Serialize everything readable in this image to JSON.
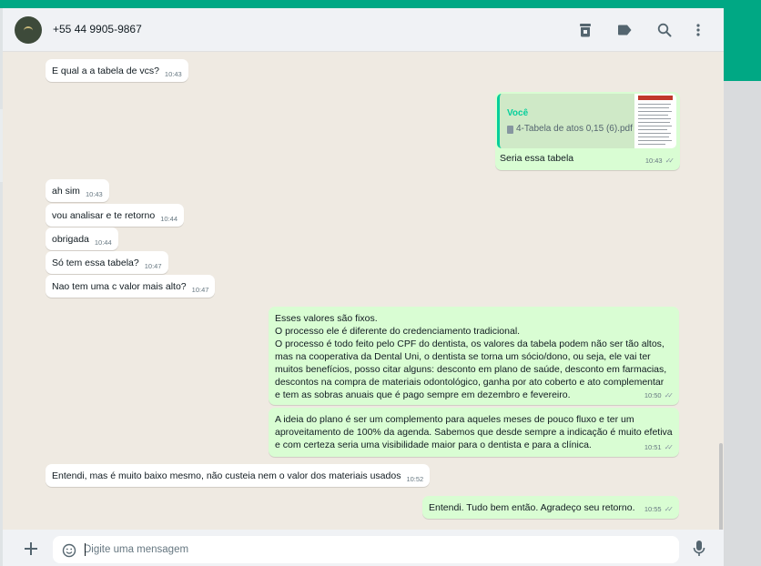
{
  "header": {
    "contact_name": "+55 44 9905-9867",
    "icons": [
      "archive-icon",
      "label-icon",
      "search-icon",
      "menu-icon"
    ]
  },
  "messages": [
    {
      "direction": "in",
      "text": "E qual a a tabela de vcs?",
      "time": "10:43"
    },
    {
      "direction": "out",
      "quote": {
        "author": "Você",
        "file": "4-Tabela de atos 0,15 (6).pdf",
        "thumb_title": "TABELA DE ATOS"
      },
      "text": "Seria essa tabela",
      "time": "10:43",
      "status": "read"
    },
    {
      "direction": "in",
      "text": "ah sim",
      "time": "10:43"
    },
    {
      "direction": "in",
      "text": "vou analisar e te retorno",
      "time": "10:44"
    },
    {
      "direction": "in",
      "text": "obrigada",
      "time": "10:44"
    },
    {
      "direction": "in",
      "text": "Só tem essa tabela?",
      "time": "10:47"
    },
    {
      "direction": "in",
      "text": "Nao tem uma c valor mais alto?",
      "time": "10:47"
    },
    {
      "direction": "out",
      "lines": [
        "Esses valores são fixos.",
        "O processo ele é diferente do credenciamento tradicional.",
        "O processo é todo feito pelo CPF do dentista, os valores da tabela podem não ser tão altos,",
        "mas na cooperativa da Dental Uni, o dentista se torna um sócio/dono, ou seja, ele vai ter",
        "muitos benefícios, posso citar alguns: desconto em plano de saúde, desconto em farmacias,",
        "descontos na compra de materiais odontológico, ganha por ato coberto e ato complementar",
        "e tem as sobras anuais que é pago sempre em dezembro e fevereiro."
      ],
      "time": "10:50",
      "status": "read"
    },
    {
      "direction": "out",
      "lines": [
        "A ideia do plano é ser um complemento para aqueles meses de pouco fluxo e ter um",
        "aproveitamento de 100% da agenda. Sabemos que desde sempre a indicação é muito efetiva",
        "e com certeza seria uma visibilidade maior para o dentista e para a clínica."
      ],
      "time": "10:51",
      "status": "read"
    },
    {
      "direction": "in",
      "text": "Entendi, mas é muito baixo mesmo, não custeia nem o valor dos materiais usados",
      "time": "10:52"
    },
    {
      "direction": "out",
      "text": "Entendi. Tudo bem então. Agradeço seu retorno.",
      "time": "10:55",
      "status": "read"
    }
  ],
  "footer": {
    "placeholder": "Digite uma mensagem",
    "value": ""
  },
  "colors": {
    "accent": "#00a884",
    "incoming_bubble": "#ffffff",
    "outgoing_bubble": "#d9fdd3",
    "chat_background": "#efeae2",
    "quote_bar": "#06cf9c"
  }
}
